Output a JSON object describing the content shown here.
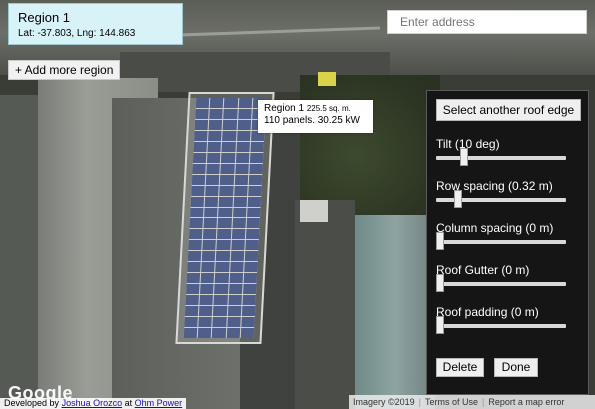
{
  "region": {
    "title": "Region 1",
    "coords": "Lat: -37.803, Lng: 144.863"
  },
  "add_region_label": "+ Add more region",
  "search": {
    "placeholder": "Enter address"
  },
  "tooltip": {
    "region": "Region 1",
    "area": "225.5 sq. m.",
    "panels_power": "110 panels. 30.25 kW"
  },
  "settings": {
    "edge_button": "Select another roof edge",
    "sliders": [
      {
        "label": "Tilt (10 deg)",
        "value_fraction": 0.2
      },
      {
        "label": "Row spacing (0.32 m)",
        "value_fraction": 0.15
      },
      {
        "label": "Column spacing (0 m)",
        "value_fraction": 0.0
      },
      {
        "label": "Roof Gutter (0 m)",
        "value_fraction": 0.0
      },
      {
        "label": "Roof padding (0 m)",
        "value_fraction": 0.0
      }
    ],
    "delete_label": "Delete",
    "done_label": "Done"
  },
  "map": {
    "logo": "Google",
    "panel_color": "#4f5f8a"
  },
  "footer": {
    "developed_by": "Developed by",
    "developer": "Joshua Orozco",
    "at": "at",
    "company": "Ohm Power",
    "imagery": "Imagery ©2019",
    "terms": "Terms of Use",
    "report": "Report a map error"
  }
}
